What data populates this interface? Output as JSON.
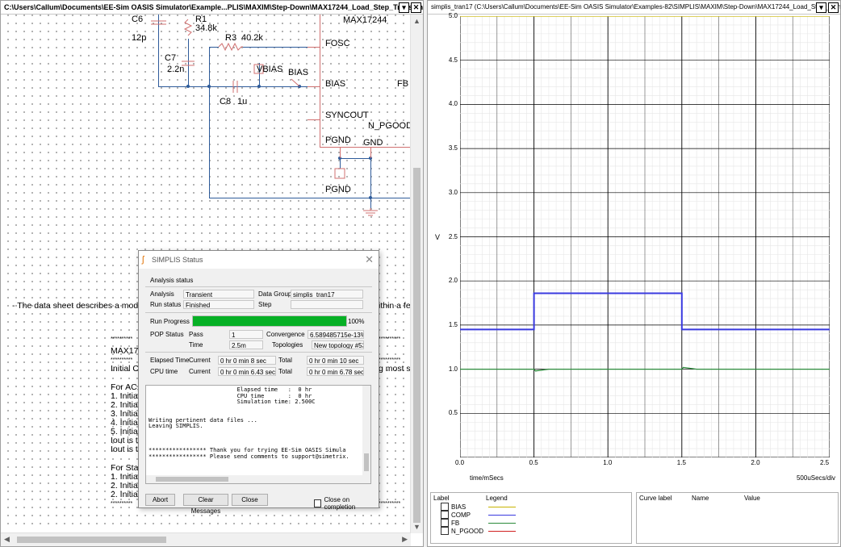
{
  "schematic_window": {
    "title": "C:\\Users\\Callum\\Documents\\EE-Sim OASIS Simulator\\Example...PLIS\\MAXIM\\Step-Down\\MAX17244_Load_Step_Transient.wxsch*",
    "labels": {
      "c6": "C6",
      "c6_val": "12p",
      "r1": "R1",
      "r1_val": "34.8k",
      "r3": "R3",
      "r3_val": "40.2k",
      "c7": "C7",
      "c7_val": "2.2n",
      "c8": "C8",
      "c8_val": "1u",
      "vbias": "VBIAS",
      "bias_net": "BIAS",
      "ic_name": "MAX17244",
      "pin_fosc": "FOSC",
      "pin_bias": "BIAS",
      "pin_fb": "FB",
      "pin_syncout": "SYNCOUT",
      "pin_npgood": "N_PGOOD",
      "pin_pgnd": "PGND",
      "pin_gnd": "GND",
      "pgnd_net": "PGND"
    },
    "text_lines": {
      "line1": "- The data sheet describes a mode f",
      "line1_right": "ithin a few",
      "stars1": "**********",
      "stars1_right": "**********",
      "stars2": "**********",
      "stars2_right": "**********",
      "max172": "MAX172",
      "initial_c": "Initial Co",
      "initial_c_right": "g most sir",
      "for_ac": "For AC,",
      "i1": "1. Initial",
      "i2": "2. Initial",
      "i3": "3. Initial",
      "i4": "4. Initial",
      "i5": "5. Initial",
      "iout1": "Iout is th",
      "iout2": "Iout is th",
      "for_star": "For Star",
      "s1": "1. Initial",
      "s2": "2.  Initia",
      "s3": "2. Initial",
      "stars3": "**********",
      "stars3_right": "**********"
    }
  },
  "status_dialog": {
    "title": "SIMPLIS Status",
    "section": "Analysis status",
    "analysis_label": "Analysis",
    "analysis_value": "Transient",
    "data_group_label": "Data Group",
    "data_group_value": "simplis_tran17",
    "run_status_label": "Run status",
    "run_status_value": "Finished",
    "step_label": "Step",
    "step_value": "",
    "run_progress_label": "Run Progress",
    "run_progress_pct": 100,
    "run_progress_text": "100%",
    "pop_status_label": "POP Status",
    "pop_pass_label": "Pass",
    "pop_pass_value": "1",
    "convergence_label": "Convergence",
    "convergence_value": "6.589485715e-13%",
    "time_label": "Time",
    "time_value": "2.5m",
    "topologies_label": "Topologies",
    "topologies_value": "New topology #53",
    "elapsed_label": "Elapsed Time",
    "elapsed_current_label": "Current",
    "elapsed_current_value": "0 hr 0 min 8  sec",
    "elapsed_total_label": "Total",
    "elapsed_total_value": "0 hr 0 min 10  sec",
    "cpu_label": "CPU time",
    "cpu_current_label": "Current",
    "cpu_current_value": "0 hr 0 min 6.43 sec",
    "cpu_total_label": "Total",
    "cpu_total_value": "0 hr 0 min 6.78 sec",
    "log_text": "                          Elapsed time   :  0 hr\n                          CPU time       :  0 hr\n                          Simulation time: 2.500C\n\n\nWriting pertinent data files ...\nLeaving SIMPLIS.\n\n\n\n***************** Thank you for trying EE-Sim OASIS Simula\n***************** Please send comments to support@simetrix.",
    "abort_label": "Abort",
    "clear_label": "Clear Messages",
    "close_label": "Close",
    "close_on_completion_label": "Close on completion"
  },
  "graph_window": {
    "title": "simplis_tran17 (C:\\Users\\Callum\\Documents\\EE-Sim OASIS Simulator\\Examples-82\\SIMPLIS\\MAXIM\\Step-Down\\MAX17244_Load_Step_Transient.wxsch)",
    "x_unit_label": "time/mSecs",
    "x_div_label": "500uSecs/div",
    "y_unit_label": "V",
    "legend_header_label": "Label",
    "legend_header_legend": "Legend",
    "cursor_header_label": "Curve label",
    "cursor_header_name": "Name",
    "cursor_header_value": "Value"
  },
  "chart_data": {
    "type": "line",
    "xlabel": "time/mSecs",
    "ylabel": "V",
    "xlim": [
      0,
      2.5
    ],
    "ylim": [
      0,
      5.0
    ],
    "x_ticks": [
      "0.0",
      "0.5",
      "1.0",
      "1.5",
      "2.0",
      "2.5"
    ],
    "y_ticks": [
      "0.5",
      "1.0",
      "1.5",
      "2.0",
      "2.5",
      "3.0",
      "3.5",
      "4.0",
      "4.5",
      "5.0"
    ],
    "grid": true,
    "series": [
      {
        "name": "BIAS",
        "color": "#c8b400",
        "x": [
          0,
          2.5
        ],
        "y": [
          5.0,
          5.0
        ]
      },
      {
        "name": "COMP",
        "color": "#3a3adf",
        "x": [
          0,
          0.5,
          0.5,
          1.5,
          1.5,
          2.5
        ],
        "y": [
          1.45,
          1.45,
          1.86,
          1.86,
          1.45,
          1.45
        ]
      },
      {
        "name": "FB",
        "color": "#2a8a3a",
        "x": [
          0,
          0.5,
          0.51,
          0.6,
          1.5,
          1.51,
          1.6,
          2.5
        ],
        "y": [
          1.0,
          1.0,
          0.98,
          1.0,
          1.0,
          1.02,
          1.0,
          1.0
        ]
      },
      {
        "name": "N_PGOOD",
        "color": "#d02020",
        "x": [],
        "y": []
      }
    ]
  }
}
